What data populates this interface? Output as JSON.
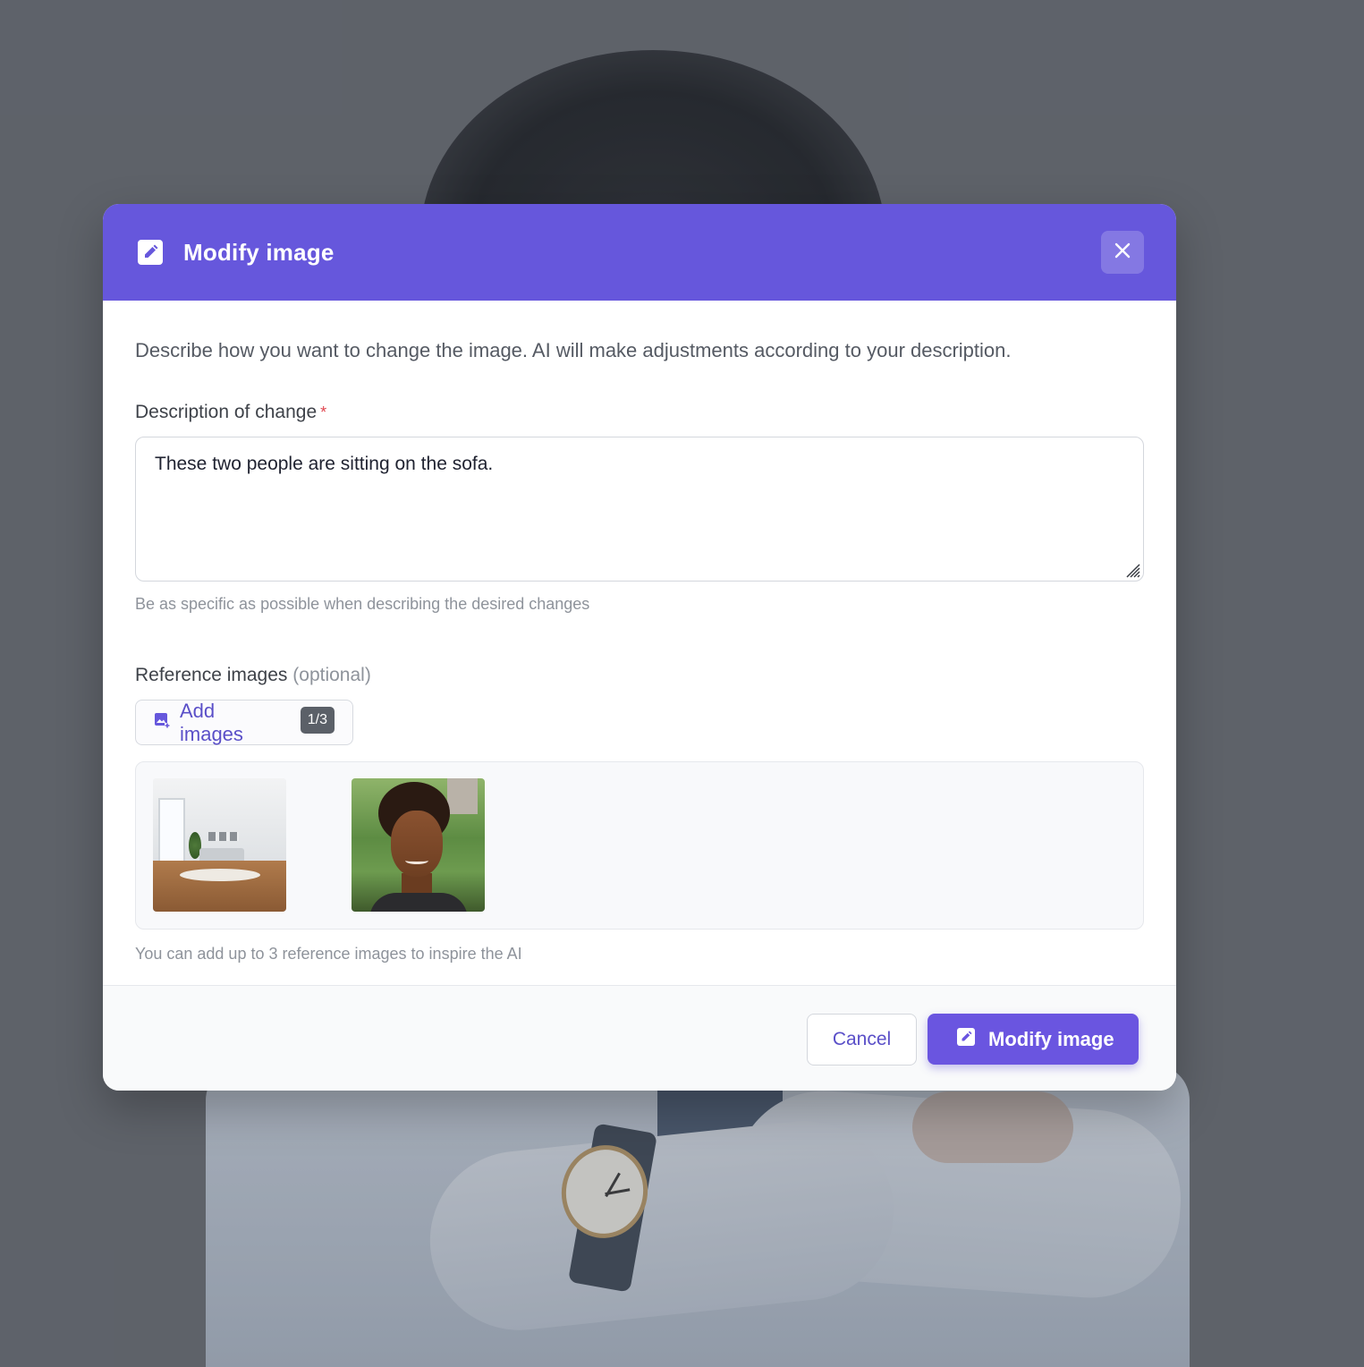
{
  "dialog": {
    "title": "Modify image",
    "header_icon": "edit-square-icon",
    "close_icon": "close-icon",
    "accent_color": "#6657dc"
  },
  "intro": "Describe how you want to change the image. AI will make adjustments according to your description.",
  "description_field": {
    "label": "Description of change",
    "required_mark": "*",
    "value": "These two people are sitting on the sofa.",
    "hint": "Be as specific as possible when describing the desired changes"
  },
  "reference_images": {
    "label": "Reference images",
    "optional_label": "(optional)",
    "add_button_label": "Add images",
    "add_icon": "add-photo-icon",
    "count_badge": "1/3",
    "images": [
      "living-room-photo",
      "woman-portrait-photo"
    ],
    "footnote": "You can add up to 3 reference images to inspire the AI"
  },
  "footer": {
    "cancel_label": "Cancel",
    "submit_label": "Modify image",
    "submit_icon": "edit-square-icon"
  }
}
